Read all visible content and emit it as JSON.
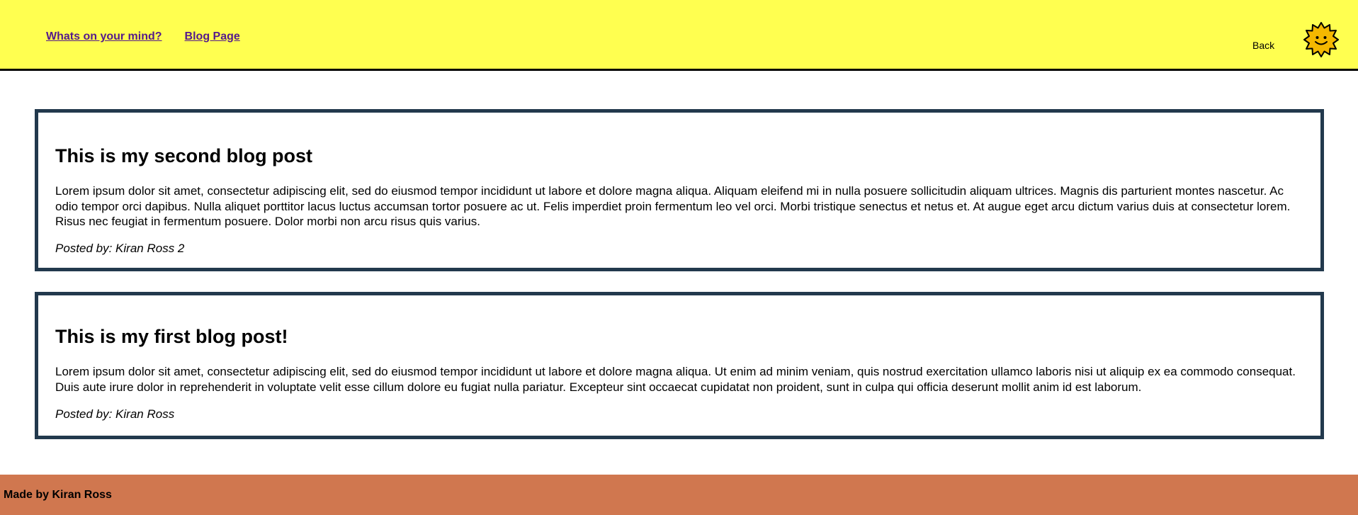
{
  "header": {
    "nav": [
      {
        "label": "Whats on your mind?"
      },
      {
        "label": "Blog Page"
      }
    ],
    "back_label": "Back",
    "logo_icon": "sun-icon",
    "background": "#ffff50"
  },
  "posts": [
    {
      "title": "This is my second blog post",
      "body": "Lorem ipsum dolor sit amet, consectetur adipiscing elit, sed do eiusmod tempor incididunt ut labore et dolore magna aliqua. Aliquam eleifend mi in nulla posuere sollicitudin aliquam ultrices. Magnis dis parturient montes nascetur. Ac odio tempor orci dapibus. Nulla aliquet porttitor lacus luctus accumsan tortor posuere ac ut. Felis imperdiet proin fermentum leo vel orci. Morbi tristique senectus et netus et. At augue eget arcu dictum varius duis at consectetur lorem. Risus nec feugiat in fermentum posuere. Dolor morbi non arcu risus quis varius.",
      "posted_by": "Posted by: Kiran Ross 2"
    },
    {
      "title": "This is my first blog post!",
      "body": "Lorem ipsum dolor sit amet, consectetur adipiscing elit, sed do eiusmod tempor incididunt ut labore et dolore magna aliqua. Ut enim ad minim veniam, quis nostrud exercitation ullamco laboris nisi ut aliquip ex ea commodo consequat. Duis aute irure dolor in reprehenderit in voluptate velit esse cillum dolore eu fugiat nulla pariatur. Excepteur sint occaecat cupidatat non proident, sunt in culpa qui officia deserunt mollit anim id est laborum.",
      "posted_by": "Posted by: Kiran Ross"
    }
  ],
  "footer": {
    "text": "Made by Kiran Ross",
    "background": "#d0774f"
  },
  "colors": {
    "post_border": "#22394d",
    "link": "#551a8b"
  }
}
